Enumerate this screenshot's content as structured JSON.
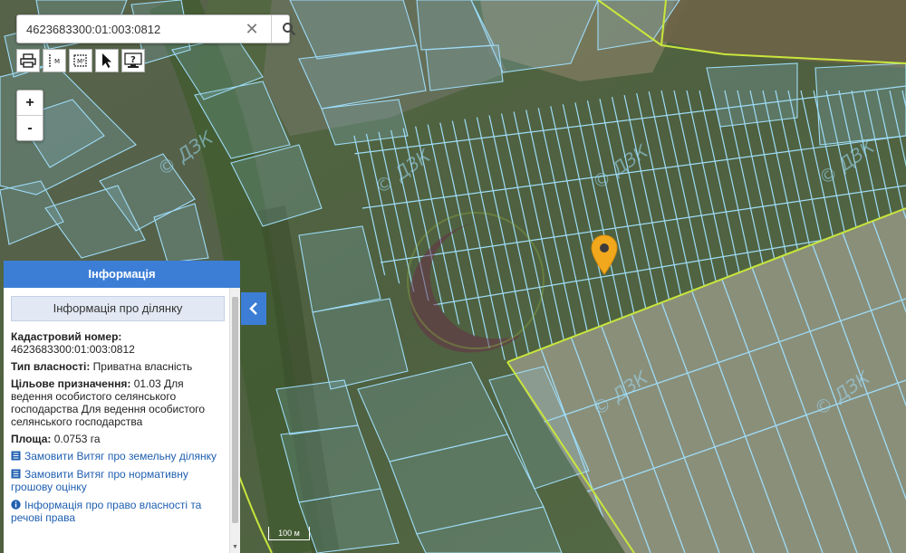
{
  "search": {
    "value": "4623683300:01:003:0812",
    "placeholder": ""
  },
  "toolbar": {
    "tools": [
      "print-icon",
      "measure-length-icon",
      "measure-area-icon",
      "pointer-icon",
      "identify-icon"
    ]
  },
  "zoom": {
    "in_label": "+",
    "out_label": "-"
  },
  "panel": {
    "title": "Інформація",
    "subtitle": "Інформація про ділянку",
    "cadastral_label": "Кадастровий номер:",
    "cadastral_value": "4623683300:01:003:0812",
    "ownership_label": "Тип власності:",
    "ownership_value": "Приватна власність",
    "purpose_label": "Цільове призначення:",
    "purpose_value": "01.03 Для ведення особистого селянського господарства Для ведення особистого селянського господарства",
    "area_label": "Площа:",
    "area_value": "0.0753 га",
    "links": [
      "Замовити Витяг про земельну ділянку",
      "Замовити Витяг про нормативну грошову оцінку",
      "Інформація про право власності та речові права"
    ]
  },
  "map": {
    "watermark": "ДЗК",
    "scale_label": "100 м"
  },
  "colors": {
    "accent": "#3c7ed6",
    "parcel": "#8fd3f5",
    "boundary": "#c8e63c",
    "marker": "#f2a81d"
  }
}
